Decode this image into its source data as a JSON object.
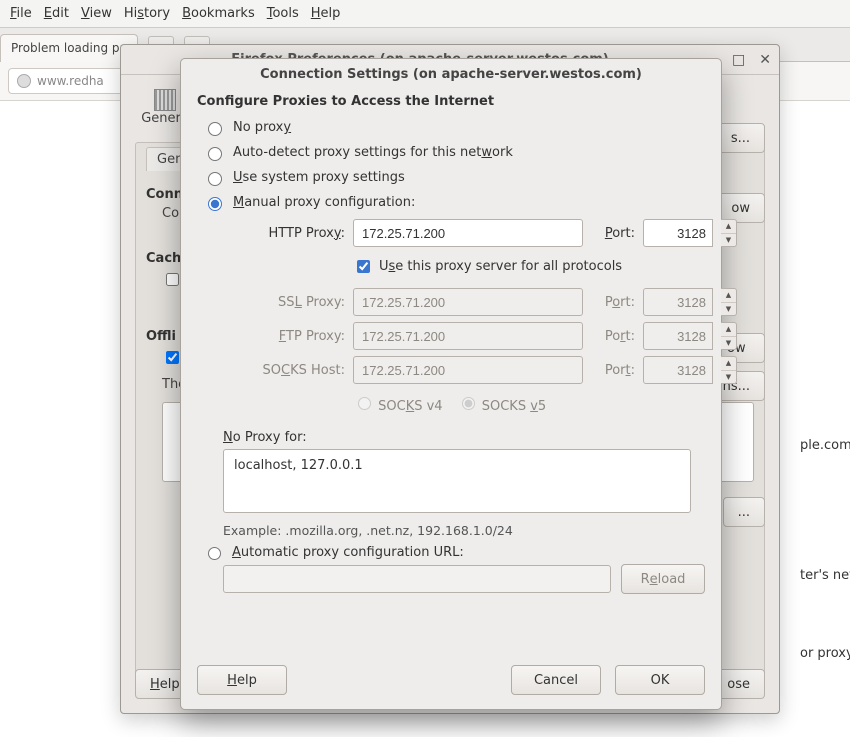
{
  "menubar": [
    "File",
    "Edit",
    "View",
    "History",
    "Bookmarks",
    "Tools",
    "Help"
  ],
  "tab_title": "Problem loading pa",
  "url_text": "www.redha",
  "error_lines": [
    "ple.com in",
    "",
    "ter's netw",
    "or proxy,"
  ],
  "prefs": {
    "title": "Firefox Preferences (on apache-server.westos.com)",
    "section": "Genera",
    "innerTab": "Genera",
    "conn_title": "Conn",
    "conn_desc": "Co",
    "conn_btn": "s...",
    "cache_title": "Cach",
    "cache_btn": "ow",
    "off_title": "Offli",
    "off_btn1": "ow",
    "off_btn2": "ns...",
    "the": "The",
    "bottom_btn": "...",
    "help": "Help",
    "close": "ose"
  },
  "modal": {
    "title": "Connection Settings (on apache-server.westos.com)",
    "heading": "Configure Proxies to Access the Internet",
    "opt_no": "No proxy",
    "opt_auto": "Auto-detect proxy settings for this network",
    "opt_sys": "Use system proxy settings",
    "opt_manual": "Manual proxy configuration:",
    "http_lbl": "HTTP Proxy:",
    "port_lbl": "Port:",
    "use_all": "Use this proxy server for all protocols",
    "ssl_lbl": "SSL Proxy:",
    "ftp_lbl": "FTP Proxy:",
    "socks_lbl": "SOCKS Host:",
    "socks4": "SOCKS v4",
    "socks5": "SOCKS v5",
    "http_val": "172.25.71.200",
    "http_port": "3128",
    "ssl_val": "172.25.71.200",
    "ssl_port": "3128",
    "ftp_val": "172.25.71.200",
    "ftp_port": "3128",
    "sh_val": "172.25.71.200",
    "sh_port": "3128",
    "noproxy_lbl": "No Proxy for:",
    "noproxy_val": "localhost, 127.0.0.1",
    "example": "Example: .mozilla.org, .net.nz, 192.168.1.0/24",
    "opt_autourl": "Automatic proxy configuration URL:",
    "reload": "Reload",
    "help": "Help",
    "cancel": "Cancel",
    "ok": "OK"
  }
}
